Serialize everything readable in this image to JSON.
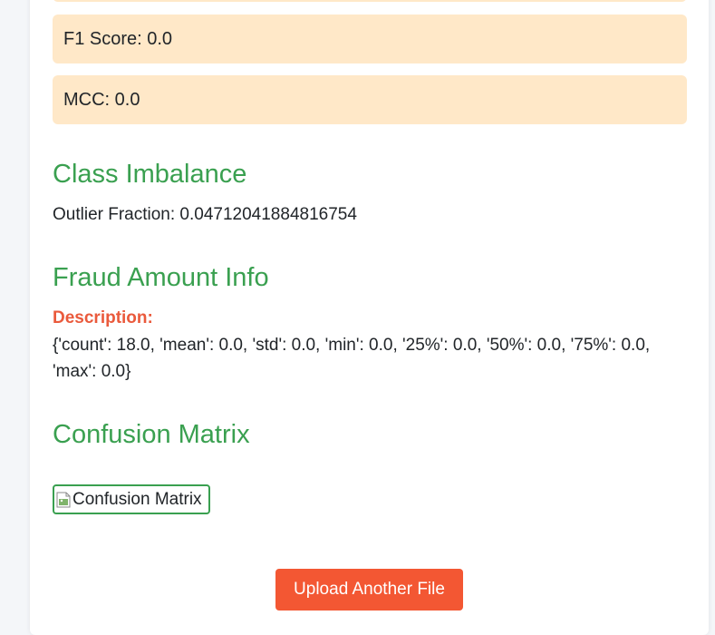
{
  "metrics": {
    "f1": "F1 Score: 0.0",
    "mcc": "MCC: 0.0"
  },
  "class_imbalance": {
    "heading": "Class Imbalance",
    "outlier_fraction": "Outlier Fraction: 0.04712041884816754"
  },
  "fraud_amount": {
    "heading": "Fraud Amount Info",
    "description_label": "Description:",
    "description_value": "{'count': 18.0, 'mean': 0.0, 'std': 0.0, 'min': 0.0, '25%': 0.0, '50%': 0.0, '75%': 0.0, 'max': 0.0}"
  },
  "confusion_matrix": {
    "heading": "Confusion Matrix",
    "image_alt": "Confusion Matrix"
  },
  "actions": {
    "upload_label": "Upload Another File"
  },
  "colors": {
    "heading": "#3aa050",
    "metric_box_bg": "#ffe8c8",
    "description_label": "#ea5a3c",
    "button_bg": "#f35733"
  },
  "icons": {
    "broken_image": "broken-image-icon"
  }
}
